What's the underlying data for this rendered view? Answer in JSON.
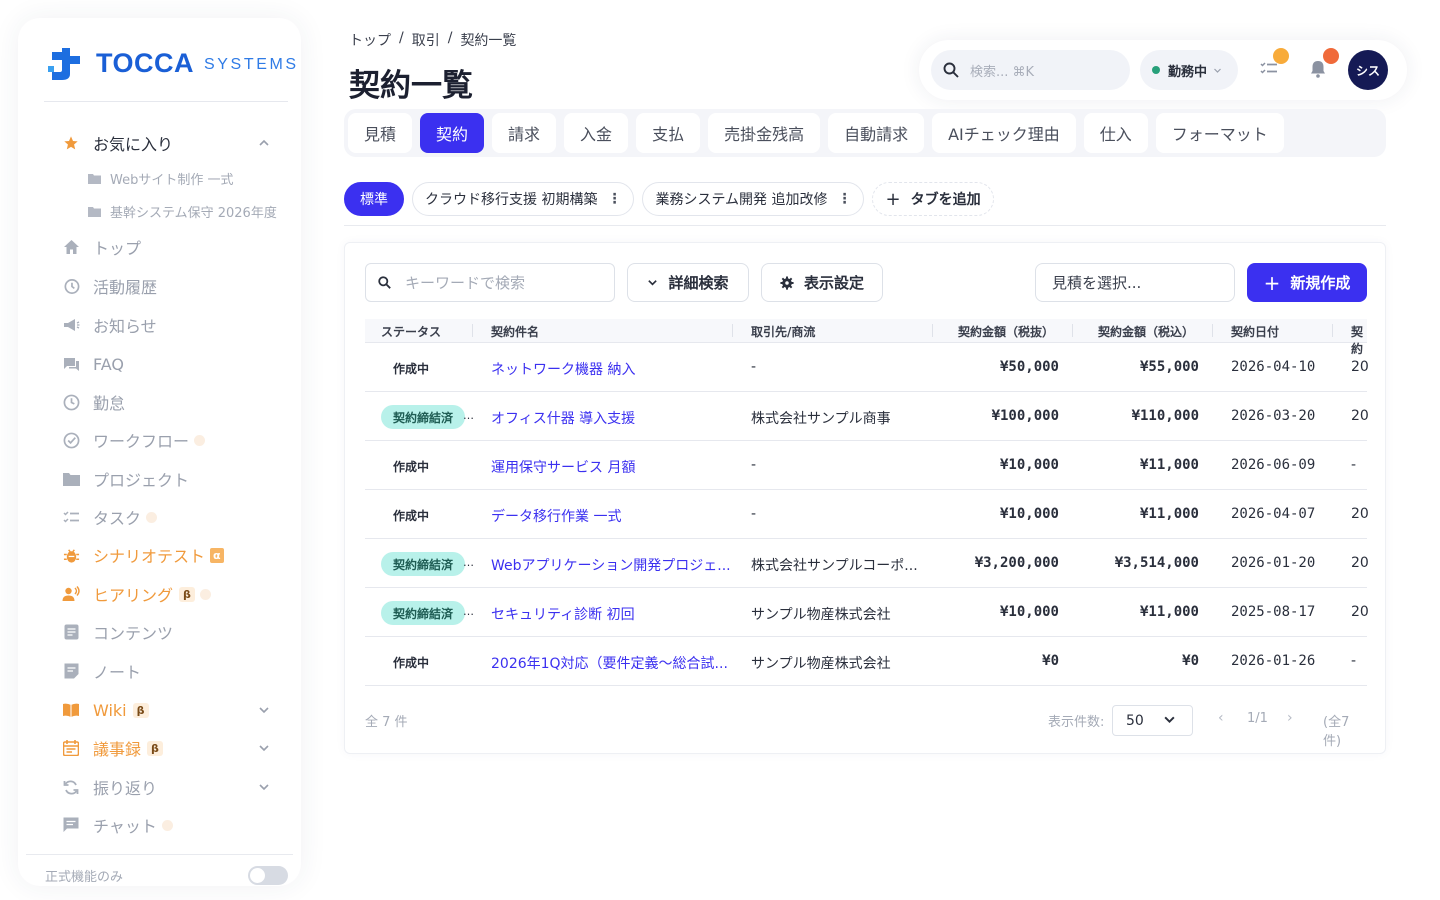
{
  "sidebar": {
    "logo": {
      "name": "TOCCA",
      "sub": "SYSTEMS"
    },
    "favorites": {
      "label": "お気に入り",
      "items": [
        "Webサイト制作 一式",
        "基幹システム保守 2026年度"
      ]
    },
    "nav": [
      {
        "label": "トップ",
        "icon": "home-icon"
      },
      {
        "label": "活動履歴",
        "icon": "history-icon"
      },
      {
        "label": "お知らせ",
        "icon": "megaphone-icon"
      },
      {
        "label": "FAQ",
        "icon": "faq-icon"
      },
      {
        "label": "勤怠",
        "icon": "clock-icon"
      },
      {
        "label": "ワークフロー",
        "icon": "check-circle-icon"
      },
      {
        "label": "プロジェクト",
        "icon": "folder-icon"
      },
      {
        "label": "タスク",
        "icon": "checklist-icon"
      },
      {
        "label": "シナリオテスト",
        "icon": "bug-icon",
        "badge": "α"
      },
      {
        "label": "ヒアリング",
        "icon": "people-icon",
        "badge": "β"
      },
      {
        "label": "コンテンツ",
        "icon": "document-icon"
      },
      {
        "label": "ノート",
        "icon": "note-icon"
      },
      {
        "label": "Wiki",
        "icon": "book-icon",
        "badge": "β"
      },
      {
        "label": "議事録",
        "icon": "calendar-icon",
        "badge": "β"
      },
      {
        "label": "振り返り",
        "icon": "refresh-icon"
      },
      {
        "label": "チャット",
        "icon": "chat-icon"
      }
    ],
    "footer": {
      "label": "正式機能のみ"
    }
  },
  "header": {
    "breadcrumb": [
      "トップ",
      "/",
      "取引",
      "/",
      "契約一覧"
    ],
    "title": "契約一覧",
    "search_placeholder": "検索... ⌘K",
    "status": "勤務中",
    "avatar": "シス"
  },
  "tabs": [
    "見積",
    "契約",
    "請求",
    "入金",
    "支払",
    "売掛金残高",
    "自動請求",
    "AIチェック理由",
    "仕入",
    "フォーマット"
  ],
  "views": {
    "standard": "標準",
    "tags": [
      "クラウド移行支援 初期構築",
      "業務システム開発 追加改修"
    ],
    "add": "タブを追加"
  },
  "toolbar": {
    "keyword_placeholder": "キーワードで検索",
    "advanced": "詳細検索",
    "display": "表示設定",
    "estimate_select": "見積を選択...",
    "create": "新規作成"
  },
  "table": {
    "headers": [
      "ステータス",
      "契約件名",
      "取引先/商流",
      "契約金額（税抜）",
      "契約金額（税込）",
      "契約日付",
      "契約"
    ],
    "rows": [
      {
        "status": "作成中",
        "name": "ネットワーク機器 納入",
        "client": "-",
        "ex": "¥50,000",
        "inc": "¥55,000",
        "date": "2026-04-10",
        "extra": "20"
      },
      {
        "status": "契約締結済",
        "name": "オフィス什器 導入支援",
        "client": "株式会社サンプル商事",
        "ex": "¥100,000",
        "inc": "¥110,000",
        "date": "2026-03-20",
        "extra": "20"
      },
      {
        "status": "作成中",
        "name": "運用保守サービス 月額",
        "client": "-",
        "ex": "¥10,000",
        "inc": "¥11,000",
        "date": "2026-06-09",
        "extra": "-"
      },
      {
        "status": "作成中",
        "name": "データ移行作業 一式",
        "client": "-",
        "ex": "¥10,000",
        "inc": "¥11,000",
        "date": "2026-04-07",
        "extra": "20"
      },
      {
        "status": "契約締結済",
        "name": "Webアプリケーション開発プロジェ...",
        "client": "株式会社サンプルコーポ...",
        "ex": "¥3,200,000",
        "inc": "¥3,514,000",
        "date": "2026-01-20",
        "extra": "20"
      },
      {
        "status": "契約締結済",
        "name": "セキュリティ診断 初回",
        "client": "サンプル物産株式会社",
        "ex": "¥10,000",
        "inc": "¥11,000",
        "date": "2025-08-17",
        "extra": "20"
      },
      {
        "status": "作成中",
        "name": "2026年1Q対応（要件定義～総合試...",
        "client": "サンプル物産株式会社",
        "ex": "¥0",
        "inc": "¥0",
        "date": "2026-01-26",
        "extra": "-"
      }
    ]
  },
  "footer": {
    "total": "全 7 件",
    "per_page_label": "表示件数:",
    "per_page": "50",
    "page": "1/1",
    "total_paren": "(全7件)"
  },
  "colors": {
    "accent": "#3b30f0",
    "orange": "#f09a3c",
    "done_badge": "#b8f1ea",
    "avatar": "#151a55"
  }
}
